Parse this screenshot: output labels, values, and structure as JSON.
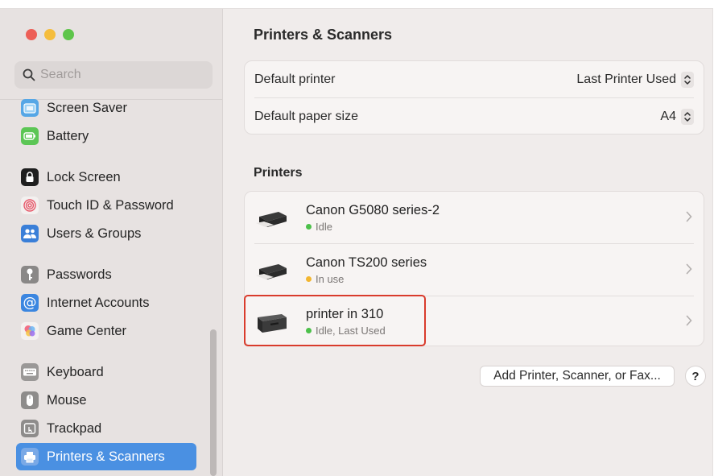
{
  "window": {
    "title": "Printers & Scanners"
  },
  "sidebar": {
    "search_placeholder": "Search",
    "items": [
      {
        "label": "Screen Saver",
        "icon": "screen-saver-icon"
      },
      {
        "label": "Battery",
        "icon": "battery-icon"
      },
      {
        "label": "Lock Screen",
        "icon": "lock-icon"
      },
      {
        "label": "Touch ID & Password",
        "icon": "fingerprint-icon"
      },
      {
        "label": "Users & Groups",
        "icon": "users-icon"
      },
      {
        "label": "Passwords",
        "icon": "key-icon"
      },
      {
        "label": "Internet Accounts",
        "icon": "at-icon"
      },
      {
        "label": "Game Center",
        "icon": "game-center-icon"
      },
      {
        "label": "Keyboard",
        "icon": "keyboard-icon"
      },
      {
        "label": "Mouse",
        "icon": "mouse-icon"
      },
      {
        "label": "Trackpad",
        "icon": "trackpad-icon"
      },
      {
        "label": "Printers & Scanners",
        "icon": "printer-icon",
        "selected": true
      }
    ]
  },
  "main": {
    "title": "Printers & Scanners",
    "defaults": {
      "default_printer_label": "Default printer",
      "default_printer_value": "Last Printer Used",
      "paper_size_label": "Default paper size",
      "paper_size_value": "A4"
    },
    "printers_section_title": "Printers",
    "printers": [
      {
        "name": "Canon G5080 series-2",
        "status": "Idle",
        "status_color": "#4cc04a"
      },
      {
        "name": "Canon TS200 series",
        "status": "In use",
        "status_color": "#f2b630"
      },
      {
        "name": "printer in 310",
        "status": "Idle, Last Used",
        "status_color": "#4cc04a"
      }
    ],
    "add_button_label": "Add Printer, Scanner, or Fax...",
    "help_label": "?"
  },
  "colors": {
    "accent": "#4a90e2",
    "highlight_border": "#d93b2c"
  }
}
